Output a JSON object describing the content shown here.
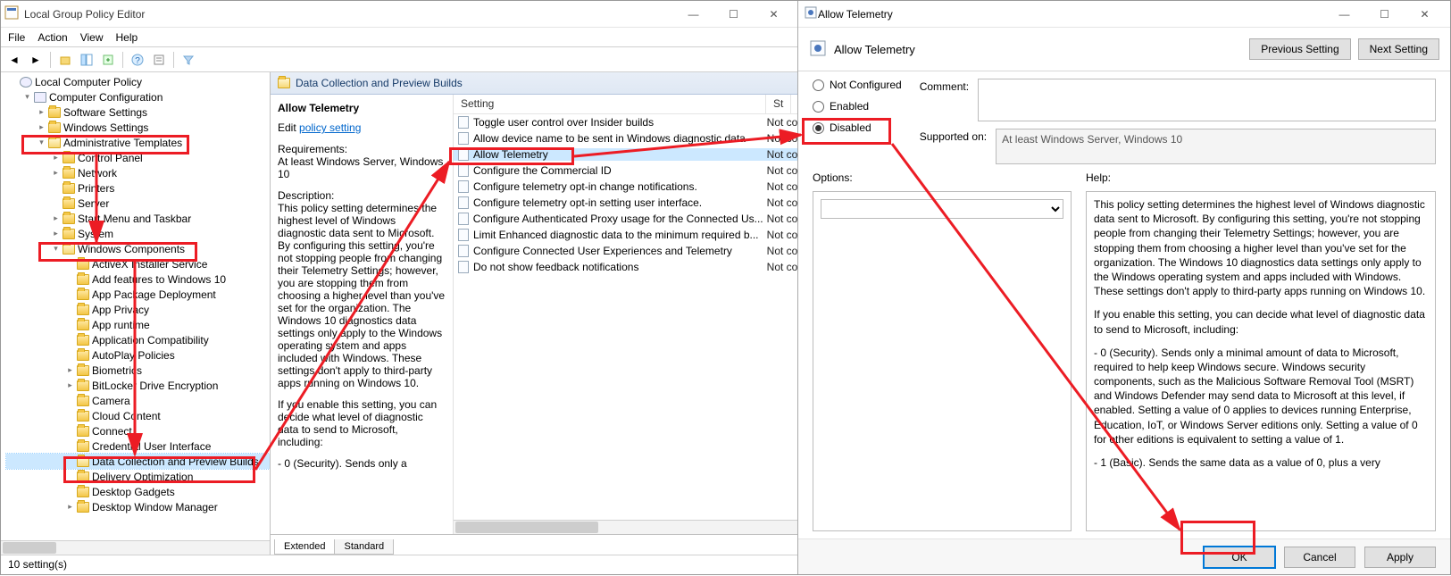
{
  "gpedit": {
    "title": "Local Group Policy Editor",
    "menus": [
      "File",
      "Action",
      "View",
      "Help"
    ],
    "status": "10 setting(s)",
    "tree": {
      "root": "Local Computer Policy",
      "compConfig": "Computer Configuration",
      "softwareSettings": "Software Settings",
      "windowsSettings": "Windows Settings",
      "adminTemplates": "Administrative Templates",
      "controlPanel": "Control Panel",
      "network": "Network",
      "printers": "Printers",
      "server": "Server",
      "startMenu": "Start Menu and Taskbar",
      "system": "System",
      "winComponents": "Windows Components",
      "activeX": "ActiveX Installer Service",
      "addFeatures": "Add features to Windows 10",
      "appPackage": "App Package Deployment",
      "appPrivacy": "App Privacy",
      "appRuntime": "App runtime",
      "appCompat": "Application Compatibility",
      "autoplay": "AutoPlay Policies",
      "biometrics": "Biometrics",
      "bitlocker": "BitLocker Drive Encryption",
      "camera": "Camera",
      "cloudContent": "Cloud Content",
      "connect": "Connect",
      "credUI": "Credential User Interface",
      "dataCollection": "Data Collection and Preview Builds",
      "deliveryOpt": "Delivery Optimization",
      "desktopGadgets": "Desktop Gadgets",
      "desktopWM": "Desktop Window Manager"
    },
    "content": {
      "headerPath": "Data Collection and Preview Builds",
      "heading": "Allow Telemetry",
      "editLabel": "Edit",
      "editLink": "policy setting",
      "reqLabel": "Requirements:",
      "reqText": "At least Windows Server, Windows 10",
      "descLabel": "Description:",
      "descText": "This policy setting determines the highest level of Windows diagnostic data sent to Microsoft. By configuring this setting, you're not stopping people from changing their Telemetry Settings; however, you are stopping them from choosing a higher level than you've set for the organization. The Windows 10 diagnostics data settings only apply to the Windows operating system and apps included with Windows. These settings don't apply to third-party apps running on Windows 10.",
      "descText2": "If you enable this setting, you can decide what level of diagnostic data to send to Microsoft, including:",
      "descText3": "  - 0 (Security). Sends only a",
      "colSetting": "Setting",
      "colState": "St",
      "settings": [
        {
          "name": "Toggle user control over Insider builds",
          "state": "Not co"
        },
        {
          "name": "Allow device name to be sent in Windows diagnostic data",
          "state": "Not co"
        },
        {
          "name": "Allow Telemetry",
          "state": "Not co"
        },
        {
          "name": "Configure the Commercial ID",
          "state": "Not co"
        },
        {
          "name": "Configure telemetry opt-in change notifications.",
          "state": "Not co"
        },
        {
          "name": "Configure telemetry opt-in setting user interface.",
          "state": "Not co"
        },
        {
          "name": "Configure Authenticated Proxy usage for the Connected Us...",
          "state": "Not co"
        },
        {
          "name": "Limit Enhanced diagnostic data to the minimum required b...",
          "state": "Not co"
        },
        {
          "name": "Configure Connected User Experiences and Telemetry",
          "state": "Not co"
        },
        {
          "name": "Do not show feedback notifications",
          "state": "Not co"
        }
      ],
      "tabExtended": "Extended",
      "tabStandard": "Standard"
    }
  },
  "dialog": {
    "title": "Allow Telemetry",
    "headTitle": "Allow Telemetry",
    "btnPrev": "Previous Setting",
    "btnNext": "Next Setting",
    "stateNotConfigured": "Not Configured",
    "stateEnabled": "Enabled",
    "stateDisabled": "Disabled",
    "commentLabel": "Comment:",
    "commentValue": "",
    "supportedLabel": "Supported on:",
    "supportedValue": "At least Windows Server, Windows 10",
    "optionsLabel": "Options:",
    "helpLabel": "Help:",
    "comboValue": "",
    "help1": "This policy setting determines the highest level of Windows diagnostic data sent to Microsoft. By configuring this setting, you're not stopping people from changing their Telemetry Settings; however, you are stopping them from choosing a higher level than you've set for the organization. The Windows 10 diagnostics data settings only apply to the Windows operating system and apps included with Windows. These settings don't apply to third-party apps running on Windows 10.",
    "help2": "If you enable this setting, you can decide what level of diagnostic data to send to Microsoft, including:",
    "help3": "  - 0 (Security). Sends only a minimal amount of data to Microsoft, required to help keep Windows secure. Windows security components, such as the Malicious Software Removal Tool (MSRT) and Windows Defender may send data to Microsoft at this level, if enabled. Setting a value of 0 applies to devices running Enterprise, Education, IoT, or Windows Server editions only. Setting a value of 0 for other editions is equivalent to setting a value of 1.",
    "help4": "  - 1 (Basic). Sends the same data as a value of 0, plus a very",
    "btnOk": "OK",
    "btnCancel": "Cancel",
    "btnApply": "Apply"
  }
}
